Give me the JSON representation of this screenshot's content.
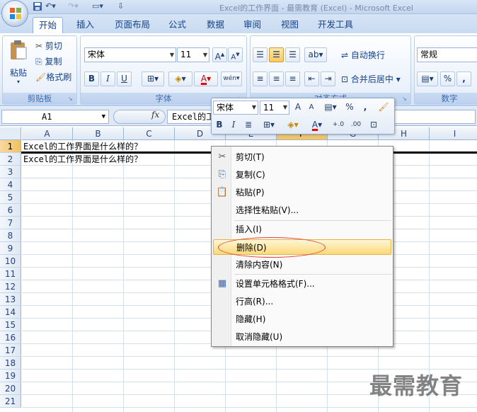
{
  "qat": {
    "title_text": "Excel的工作界面 - 最需教育 (Excel) - Microsoft Excel"
  },
  "tabs": [
    {
      "label": "开始",
      "active": true
    },
    {
      "label": "插入"
    },
    {
      "label": "页面布局"
    },
    {
      "label": "公式"
    },
    {
      "label": "数据"
    },
    {
      "label": "审阅"
    },
    {
      "label": "视图"
    },
    {
      "label": "开发工具"
    }
  ],
  "ribbon": {
    "clipboard": {
      "paste": "粘贴",
      "cut": "剪切",
      "copy": "复制",
      "format_painter": "格式刷",
      "group": "剪贴板"
    },
    "font": {
      "name": "宋体",
      "size": "11",
      "bold": "B",
      "italic": "I",
      "underline": "U",
      "font_color": "A",
      "group": "字体"
    },
    "alignment": {
      "wrap": "自动换行",
      "merge": "合并后居中",
      "group": "对齐方式"
    },
    "number": {
      "format": "常规",
      "percent": "%",
      "comma": ",",
      "group": "数字"
    }
  },
  "formula_bar": {
    "name_box": "A1",
    "fx": "fx",
    "content": "Excel的工作界面是什么样的？"
  },
  "grid": {
    "columns": [
      "A",
      "B",
      "C",
      "D",
      "E",
      "F",
      "G",
      "H",
      "I"
    ],
    "highlighted_column": "F",
    "rows": [
      "1",
      "2",
      "3",
      "4",
      "5",
      "6",
      "7",
      "8",
      "9",
      "10",
      "11",
      "12",
      "13",
      "14",
      "15",
      "16",
      "17",
      "18",
      "19",
      "20",
      "21"
    ],
    "highlighted_row": "1",
    "cells": {
      "A1": "Excel的工作界面是什么样的？",
      "A2": "Excel的工作界面是什么样的？"
    }
  },
  "minibar": {
    "font": "宋体",
    "size": "11",
    "grow": "A",
    "shrink": "A",
    "percent": "%",
    "comma": ",",
    "bold": "B",
    "italic": "I",
    "font_color": "A",
    "inc_decimal": "+.0",
    "dec_decimal": ".00"
  },
  "context_menu": {
    "items": [
      {
        "label": "剪切(T)"
      },
      {
        "label": "复制(C)"
      },
      {
        "label": "粘贴(P)"
      },
      {
        "label": "选择性粘贴(V)..."
      },
      {
        "label": "插入(I)"
      },
      {
        "label": "删除(D)",
        "highlighted": true
      },
      {
        "label": "清除内容(N)"
      },
      {
        "label": "设置单元格格式(F)..."
      },
      {
        "label": "行高(R)..."
      },
      {
        "label": "隐藏(H)"
      },
      {
        "label": "取消隐藏(U)"
      }
    ]
  },
  "watermark": "最需教育",
  "colors": {
    "accent": "#15428b",
    "highlight": "#fbd97a",
    "annotation": "#e04040"
  }
}
